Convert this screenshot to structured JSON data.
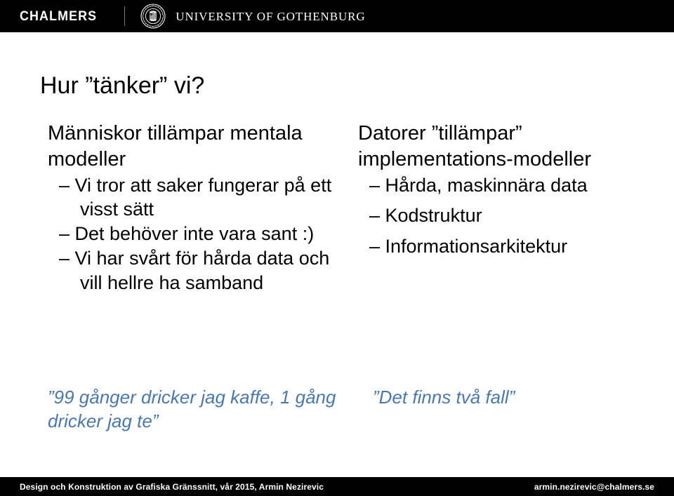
{
  "header": {
    "chalmers_logo_text": "CHALMERS",
    "gu_logo_text": "UNIVERSITY OF GOTHENBURG",
    "seal_icon": "gothenburg-university-seal",
    "divider_icon": "vertical-divider",
    "background_color": "#000000",
    "text_color": "#ffffff"
  },
  "slide": {
    "title": "Hur ”tänker” vi?",
    "background_color": "#ffffff",
    "text_color": "#000000",
    "accent_color": "#4a78ab"
  },
  "left_column": {
    "lead": "Människor tillämpar mentala modeller",
    "bullets": [
      "– Vi tror att saker fungerar på ett visst sätt",
      "– Det behöver inte vara sant  :)",
      "– Vi har svårt för hårda data och vill hellre ha samband"
    ],
    "quote": "”99 gånger dricker jag kaffe, 1 gång dricker jag te”"
  },
  "right_column": {
    "lead": "Datorer ”tillämpar” implementations-modeller",
    "bullets": [
      "– Hårda, maskinnära data",
      "– Kodstruktur",
      "– Informationsarkitektur"
    ],
    "quote": "”Det finns två fall”"
  },
  "footer": {
    "course_info": "Design och Konstruktion av Grafiska Gränssnitt,  vår 2015, Armin Nezirevic",
    "email": "armin.nezirevic@chalmers.se",
    "background_color": "#000000",
    "text_color": "#ffffff"
  }
}
